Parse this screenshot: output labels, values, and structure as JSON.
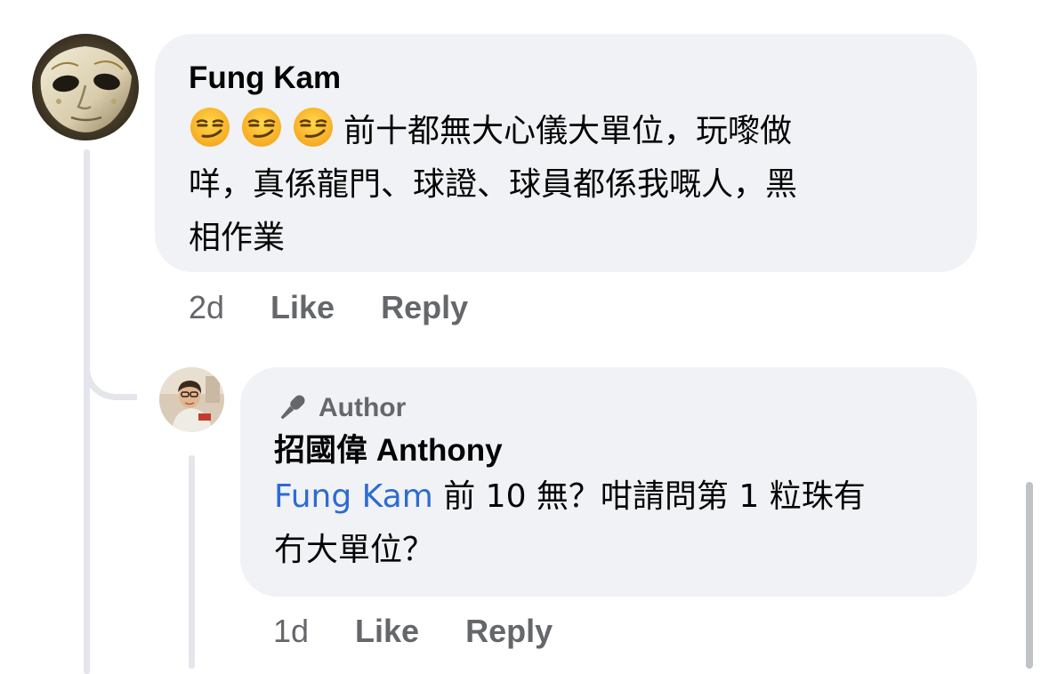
{
  "comment": {
    "author": "Fung Kam",
    "emoji": [
      "smirk",
      "smirk",
      "smirk"
    ],
    "text": "前十都無大心儀大單位，玩嚟做\n咩，真係龍門、球證、球員都係我嘅人，黑\n相作業",
    "time": "2d",
    "like_label": "Like",
    "reply_label": "Reply"
  },
  "reply": {
    "badge_icon": "microphone-icon",
    "badge": "Author",
    "author": "招國偉 Anthony",
    "mention": "Fung Kam",
    "text": " 前 10 無？咁請問第 1 粒珠有\n冇大單位？",
    "time": "1d",
    "like_label": "Like",
    "reply_label": "Reply"
  },
  "colors": {
    "bubble": "#f0f2f5",
    "secondary_text": "#65676b",
    "mention_link": "#2d6bd4",
    "thread_line": "#e4e6eb"
  }
}
